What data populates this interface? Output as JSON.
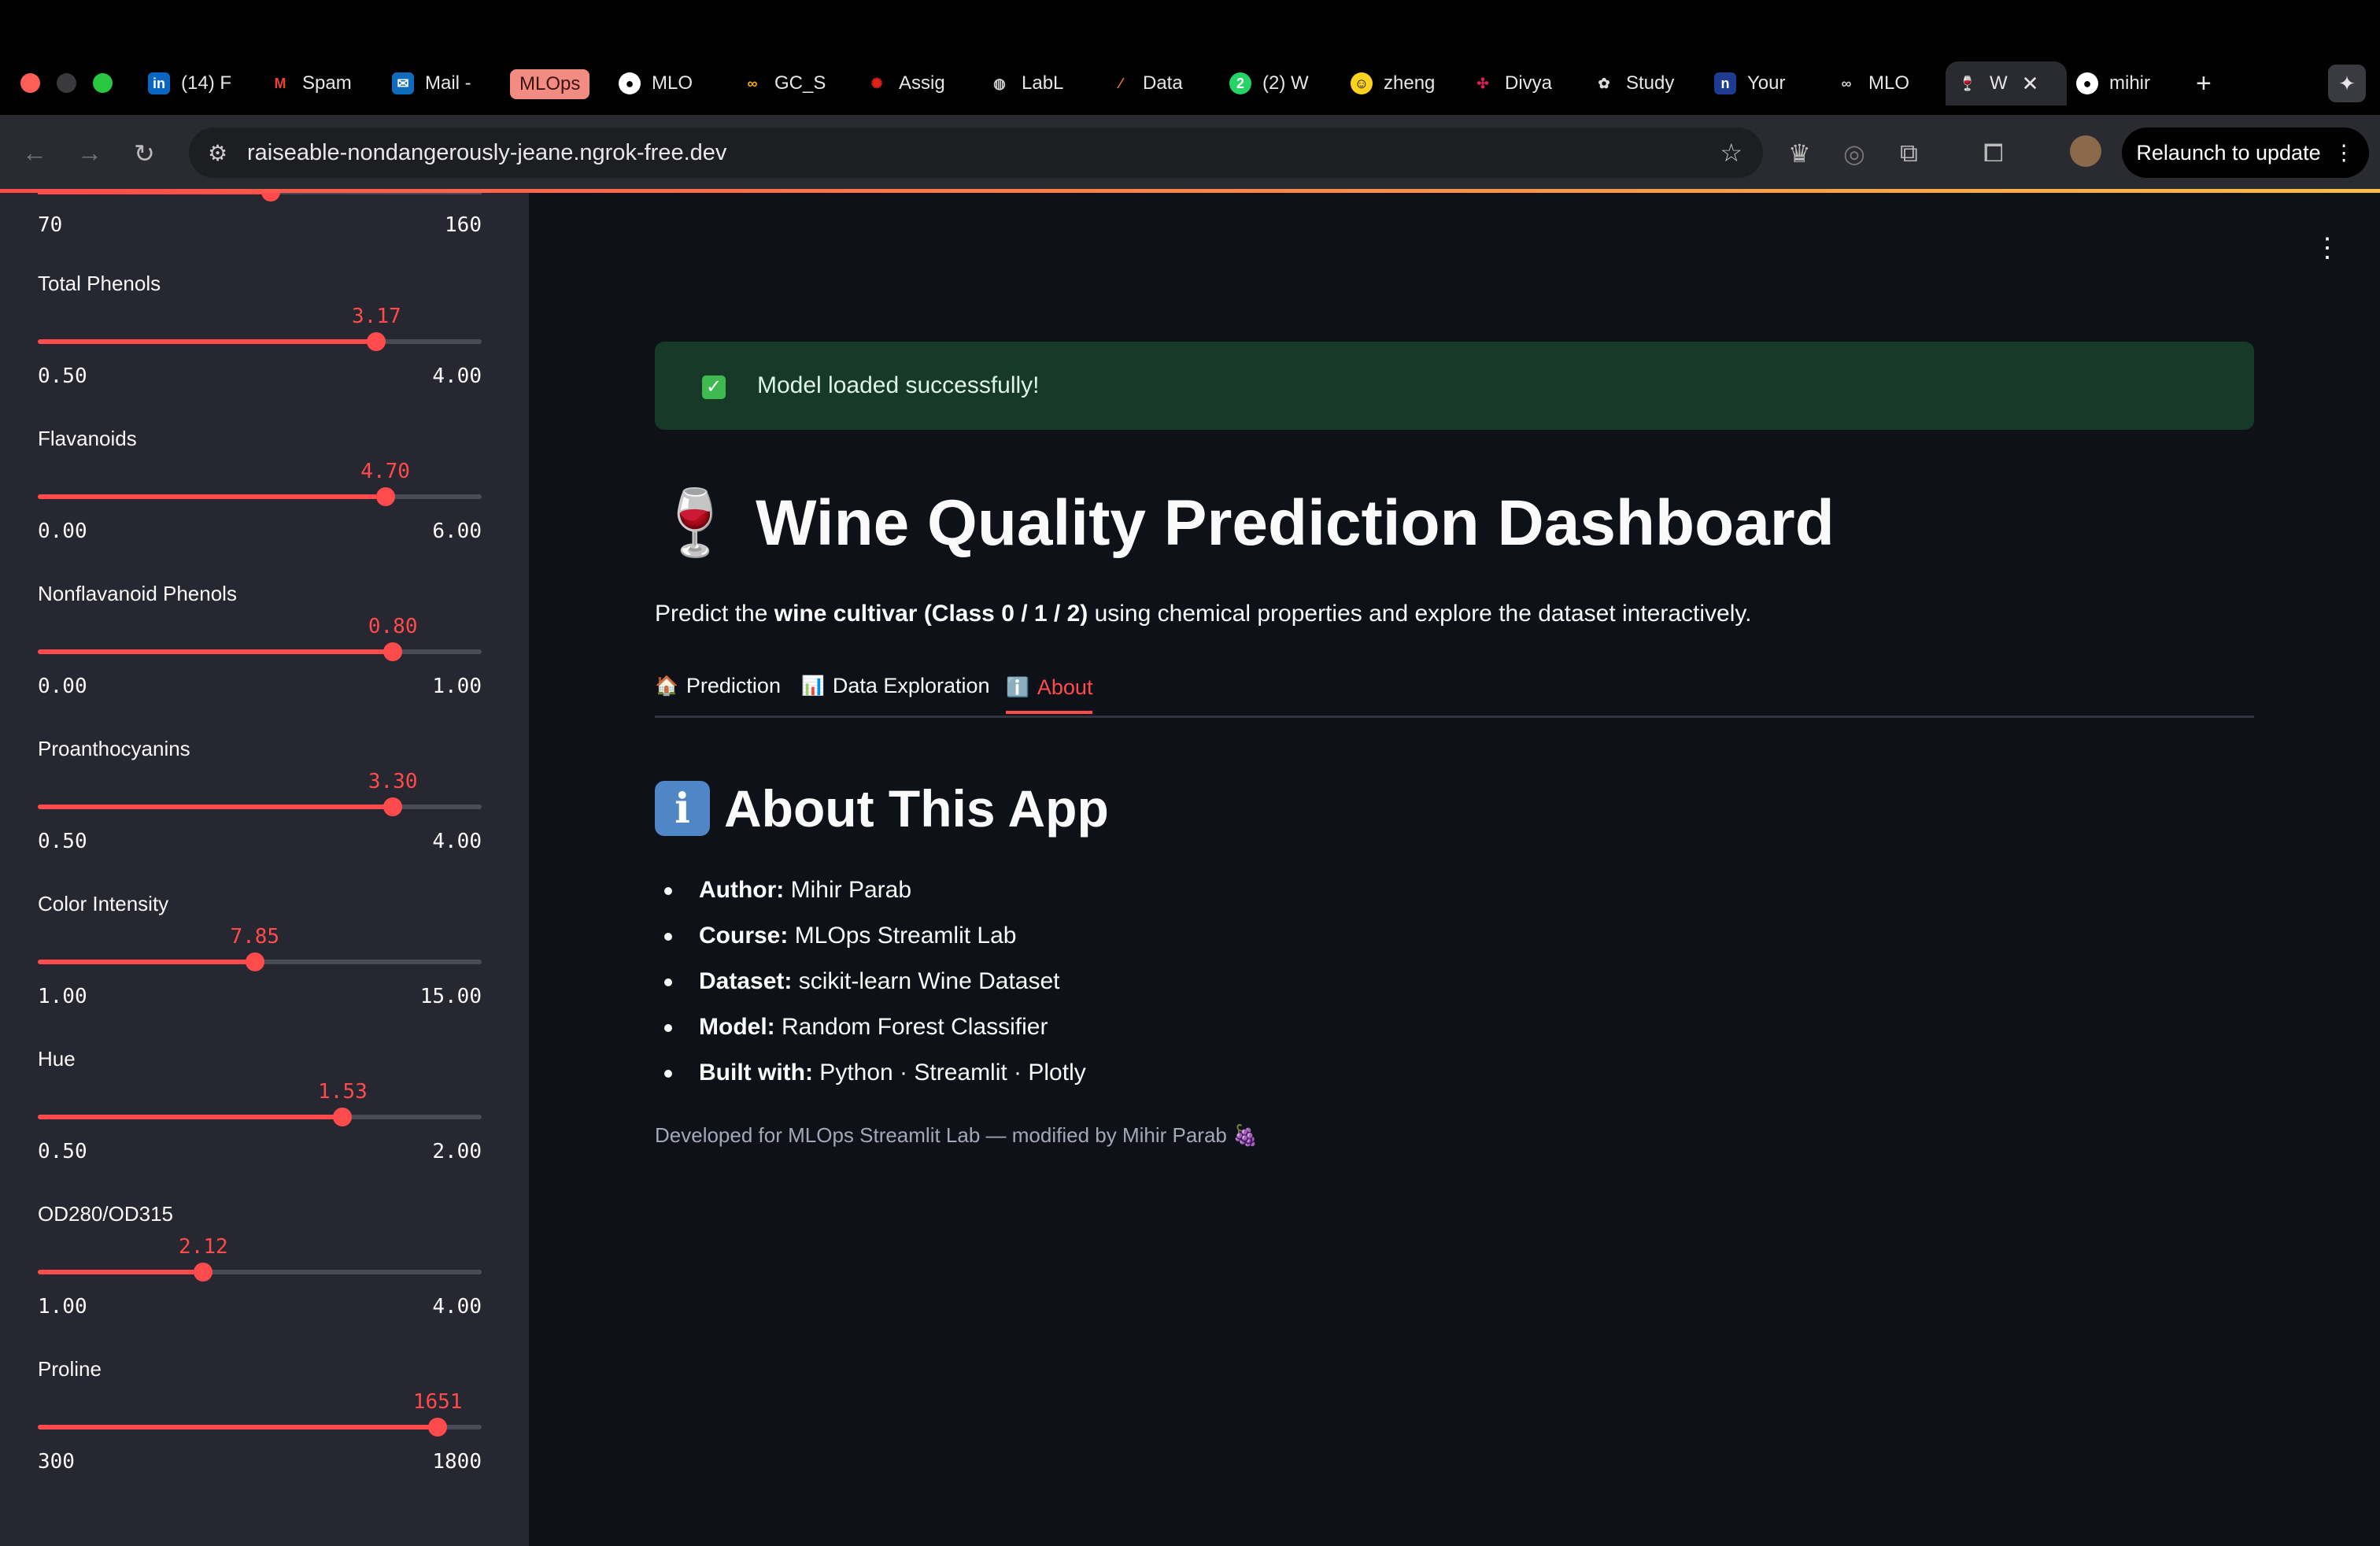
{
  "browser": {
    "tabs": [
      {
        "label": "(14) F",
        "icon": "linkedin-icon"
      },
      {
        "label": "Spam",
        "icon": "gmail-icon"
      },
      {
        "label": "Mail -",
        "icon": "outlook-icon"
      },
      {
        "label": "MLOps",
        "icon": "tab-group-badge"
      },
      {
        "label": "MLO",
        "icon": "github-icon"
      },
      {
        "label": "GC_S",
        "icon": "colab-icon"
      },
      {
        "label": "Assig",
        "icon": "canvas-icon"
      },
      {
        "label": "LabL",
        "icon": "globe-icon"
      },
      {
        "label": "Data",
        "icon": "tableau-icon"
      },
      {
        "label": "(2) W",
        "icon": "whatsapp-icon"
      },
      {
        "label": "zheng",
        "icon": "huggingface-icon"
      },
      {
        "label": "Divya",
        "icon": "slack-icon"
      },
      {
        "label": "Study",
        "icon": "openai-icon"
      },
      {
        "label": "Your",
        "icon": "notion-icon"
      },
      {
        "label": "MLO",
        "icon": "colab-icon"
      },
      {
        "label": "W",
        "icon": "wine-glass-icon"
      },
      {
        "label": "mihir",
        "icon": "github-icon"
      }
    ],
    "url": "raiseable-nondangerously-jeane.ngrok-free.dev",
    "relaunch_label": "Relaunch to update"
  },
  "sidebar": {
    "partial_slider": {
      "min": "70",
      "max": "160"
    },
    "sliders": [
      {
        "label": "Total Phenols",
        "value": "3.17",
        "min": "0.50",
        "max": "4.00",
        "fraction": 0.763
      },
      {
        "label": "Flavanoids",
        "value": "4.70",
        "min": "0.00",
        "max": "6.00",
        "fraction": 0.783
      },
      {
        "label": "Nonflavanoid Phenols",
        "value": "0.80",
        "min": "0.00",
        "max": "1.00",
        "fraction": 0.8
      },
      {
        "label": "Proanthocyanins",
        "value": "3.30",
        "min": "0.50",
        "max": "4.00",
        "fraction": 0.8
      },
      {
        "label": "Color Intensity",
        "value": "7.85",
        "min": "1.00",
        "max": "15.00",
        "fraction": 0.489
      },
      {
        "label": "Hue",
        "value": "1.53",
        "min": "0.50",
        "max": "2.00",
        "fraction": 0.687
      },
      {
        "label": "OD280/OD315",
        "value": "2.12",
        "min": "1.00",
        "max": "4.00",
        "fraction": 0.373
      },
      {
        "label": "Proline",
        "value": "1651",
        "min": "300",
        "max": "1800",
        "fraction": 0.901
      }
    ]
  },
  "main": {
    "alert": "Model loaded successfully!",
    "title_emoji": "🍷",
    "title": "Wine Quality Prediction Dashboard",
    "subtitle_pre": "Predict the ",
    "subtitle_bold": "wine cultivar (Class 0 / 1 / 2)",
    "subtitle_post": " using chemical properties and explore the dataset interactively.",
    "tabs": [
      {
        "emoji": "🏠",
        "label": "Prediction"
      },
      {
        "emoji": "📊",
        "label": "Data Exploration"
      },
      {
        "emoji": "ℹ️",
        "label": "About"
      }
    ],
    "about_heading": "About This App",
    "about_items": [
      {
        "key": "Author:",
        "value": " Mihir Parab"
      },
      {
        "key": "Course:",
        "value": " MLOps Streamlit Lab"
      },
      {
        "key": "Dataset:",
        "value": " scikit-learn Wine Dataset"
      },
      {
        "key": "Model:",
        "value": " Random Forest Classifier"
      },
      {
        "key": "Built with:",
        "value": " Python · Streamlit · Plotly"
      }
    ],
    "footer": "Developed for MLOps Streamlit Lab — modified by Mihir Parab 🍇"
  },
  "colors": {
    "accent": "#ff4b4b",
    "alert_bg": "#173928",
    "sidebar_bg": "#262730",
    "main_bg": "#0e1117"
  }
}
